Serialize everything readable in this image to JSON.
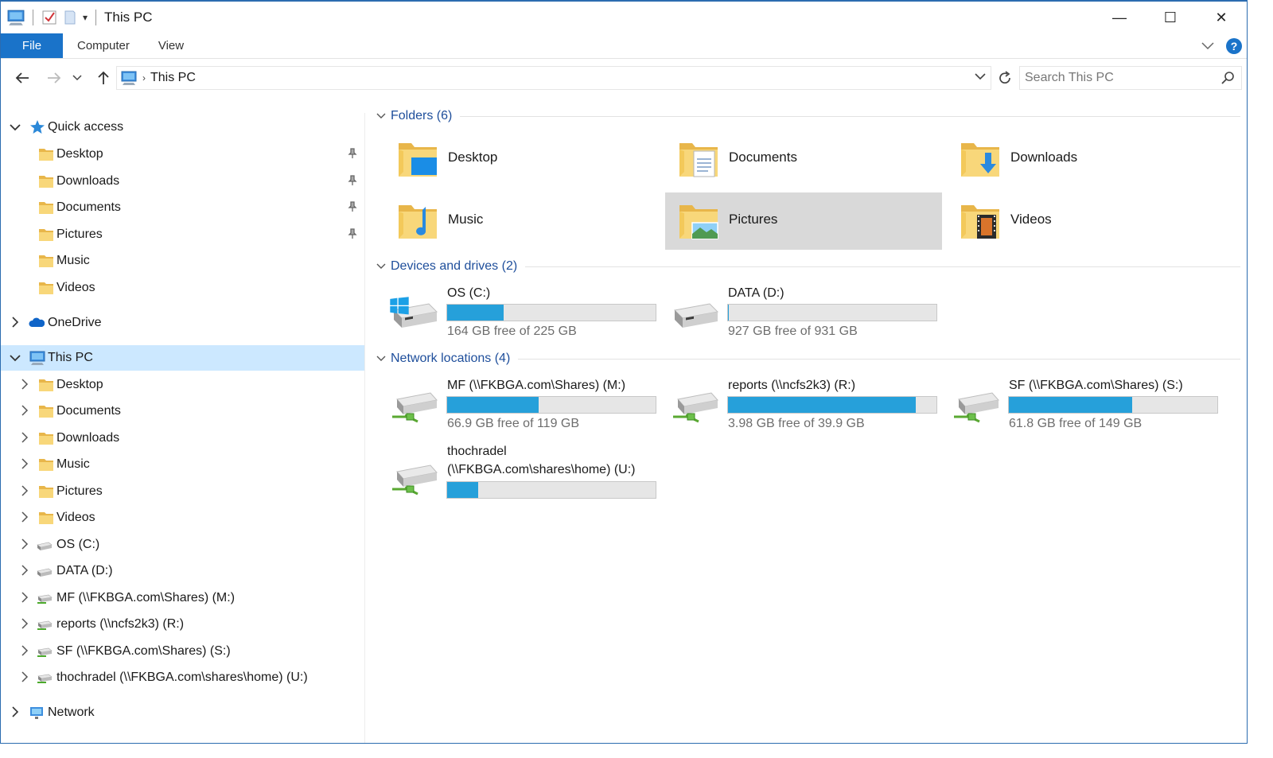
{
  "window": {
    "title": "This PC",
    "controls": {
      "minimize": "—",
      "maximize": "☐",
      "close": "✕"
    }
  },
  "ribbon": {
    "tabs": [
      "File",
      "Computer",
      "View"
    ]
  },
  "address": {
    "breadcrumb": "This PC",
    "search_placeholder": "Search This PC"
  },
  "nav": {
    "quick_access": {
      "label": "Quick access",
      "items": [
        "Desktop",
        "Downloads",
        "Documents",
        "Pictures",
        "Music",
        "Videos"
      ]
    },
    "onedrive": "OneDrive",
    "this_pc": {
      "label": "This PC",
      "items": [
        "Desktop",
        "Documents",
        "Downloads",
        "Music",
        "Pictures",
        "Videos",
        "OS (C:)",
        "DATA (D:)",
        "MF (\\\\FKBGA.com\\Shares) (M:)",
        "reports (\\\\ncfs2k3) (R:)",
        "SF (\\\\FKBGA.com\\Shares) (S:)",
        "thochradel (\\\\FKBGA.com\\shares\\home) (U:)"
      ]
    },
    "network": "Network"
  },
  "content": {
    "folders_header": "Folders (6)",
    "folders": [
      "Desktop",
      "Documents",
      "Downloads",
      "Music",
      "Pictures",
      "Videos"
    ],
    "devices_header": "Devices and drives (2)",
    "devices": [
      {
        "name": "OS (C:)",
        "free": "164 GB free of 225 GB",
        "used_fraction": 0.27
      },
      {
        "name": "DATA (D:)",
        "free": "927 GB free of 931 GB",
        "used_fraction": 0.004
      }
    ],
    "network_header": "Network locations (4)",
    "network": [
      {
        "name": "MF (\\\\FKBGA.com\\Shares) (M:)",
        "free": "66.9 GB free of 119 GB",
        "used_fraction": 0.44
      },
      {
        "name": "reports (\\\\ncfs2k3) (R:)",
        "free": "3.98 GB free of 39.9 GB",
        "used_fraction": 0.9
      },
      {
        "name": "SF (\\\\FKBGA.com\\Shares) (S:)",
        "free": "61.8 GB free of 149 GB",
        "used_fraction": 0.59
      },
      {
        "name_line1": "thochradel",
        "name_line2": "(\\\\FKBGA.com\\shares\\home) (U:)",
        "used_fraction": 0.15
      }
    ]
  },
  "colors": {
    "accent": "#1a73c9",
    "bar_fill": "#26a0da",
    "selection": "#cce8ff",
    "group_title": "#1e4e9b"
  }
}
